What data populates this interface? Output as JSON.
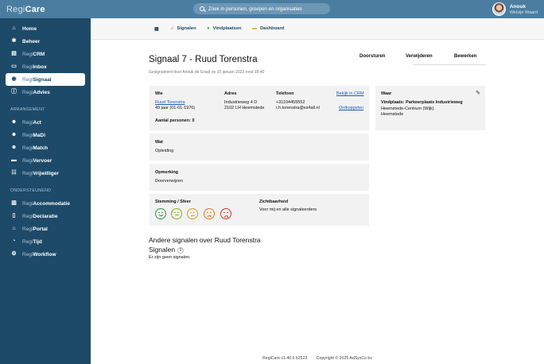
{
  "app": {
    "logo_regi": "Regi",
    "logo_care": "Care"
  },
  "search": {
    "placeholder": "Zoek in personen, groepen en organisaties"
  },
  "user": {
    "name": "Anouk",
    "org": "Welzijn Waard"
  },
  "sidebar": {
    "main_items": [
      {
        "prefix": "",
        "label": "Home",
        "icon": "home-icon"
      },
      {
        "prefix": "",
        "label": "Beheer",
        "icon": "gear-icon"
      },
      {
        "prefix": "Regi",
        "label": "CRM",
        "icon": "id-card-icon"
      },
      {
        "prefix": "Regi",
        "label": "Inbox",
        "icon": "inbox-icon"
      },
      {
        "prefix": "Regi",
        "label": "Signaal",
        "icon": "eye-icon",
        "active": true
      },
      {
        "prefix": "Regi",
        "label": "Advies",
        "icon": "info-icon"
      }
    ],
    "section_arrangement": "ARRANGEMENT",
    "arrangement_items": [
      {
        "prefix": "Regi",
        "label": "Act",
        "icon": "users-icon"
      },
      {
        "prefix": "Regi",
        "label": "MaDi",
        "icon": "users-icon"
      },
      {
        "prefix": "Regi",
        "label": "Match",
        "icon": "users-icon"
      },
      {
        "prefix": "Regi",
        "label": "Vervoer",
        "icon": "car-icon"
      },
      {
        "prefix": "Regi",
        "label": "Vrijwilliger",
        "icon": "handshake-icon"
      }
    ],
    "section_support": "ONDERSTEUNEND",
    "support_items": [
      {
        "prefix": "Regi",
        "label": "Accommodatie",
        "icon": "building-icon"
      },
      {
        "prefix": "Regi",
        "label": "Declaratie",
        "icon": "document-icon"
      },
      {
        "prefix": "Regi",
        "label": "Portal",
        "icon": "house-icon"
      },
      {
        "prefix": "Regi",
        "label": "Tijd",
        "icon": "stopwatch-icon"
      },
      {
        "prefix": "Regi",
        "label": "Workflow",
        "icon": "workflow-icon"
      }
    ]
  },
  "tabs": {
    "signalen": "Signalen",
    "vindplaatsen": "Vindplaatsen",
    "dashboard": "Dashboard"
  },
  "page": {
    "title": "Signaal 7 - Ruud Torenstra",
    "subtitle": "Gesignaleerd door Anouk de Graaf op 10 januari 2023 rond 18:40",
    "actions": {
      "forward": "Doorsturen",
      "delete": "Verwijderen",
      "edit": "Bewerken"
    }
  },
  "who": {
    "label_wie": "Wie",
    "label_adres": "Adres",
    "label_telefoon": "Telefoon",
    "crm_link": "Bekijk in CRM",
    "name": "Ruud Torenstra",
    "age": "49 jaar (01-01-1976)",
    "street": "Industrieweg 4 D",
    "city": "2102 LH Heemstede",
    "phone": "+31104455552",
    "email": "r.h.torenstra@xs4all.nl",
    "unlink": "Ontkoppelen",
    "count_label": "Aantal personen: 0"
  },
  "where": {
    "label": "Waar",
    "place": "Vindplaats: Parkeerplaats Industrieweg",
    "area": "Heemstede-Centrum (Wijk)",
    "town": "Heemstede"
  },
  "what": {
    "label": "Wat",
    "value": "Opleiding"
  },
  "remark": {
    "label": "Opmerking",
    "value": "Doorverwijzen"
  },
  "mood": {
    "label": "Stemming / Sfeer",
    "visibility_label": "Zichtbaarheid",
    "visibility_value": "Voor mij en alle signaleerders",
    "faces": [
      {
        "icon": "very-happy-face-icon",
        "color": "#2e9e44"
      },
      {
        "icon": "happy-face-icon",
        "color": "#8fae1e"
      },
      {
        "icon": "neutral-face-icon",
        "color": "#d6a41e"
      },
      {
        "icon": "sad-face-icon",
        "color": "#e07b1c"
      },
      {
        "icon": "very-sad-face-icon",
        "color": "#d23a2a"
      }
    ]
  },
  "other": {
    "heading": "Andere signalen over Ruud Torenstra",
    "signals_label": "Signalen",
    "signals_count": "0",
    "empty": "Er zijn geen signalen."
  },
  "footer": {
    "version": "RegiCare v1.40.5 b2523",
    "copyright": "Copyright © 2025 AdSysCo bv"
  },
  "colors": {
    "sidebar": "#1d4a69",
    "topbar": "#4a7da0",
    "link": "#1a5fb4"
  }
}
